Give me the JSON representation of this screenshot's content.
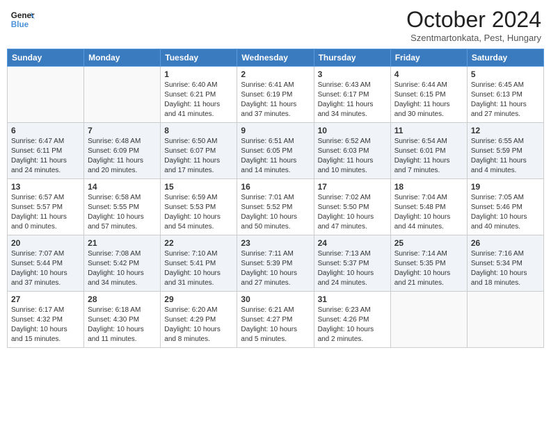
{
  "header": {
    "logo_line1": "General",
    "logo_line2": "Blue",
    "month_title": "October 2024",
    "location": "Szentmartonkata, Pest, Hungary"
  },
  "weekdays": [
    "Sunday",
    "Monday",
    "Tuesday",
    "Wednesday",
    "Thursday",
    "Friday",
    "Saturday"
  ],
  "weeks": [
    [
      {
        "day": "",
        "content": ""
      },
      {
        "day": "",
        "content": ""
      },
      {
        "day": "1",
        "content": "Sunrise: 6:40 AM\nSunset: 6:21 PM\nDaylight: 11 hours and 41 minutes."
      },
      {
        "day": "2",
        "content": "Sunrise: 6:41 AM\nSunset: 6:19 PM\nDaylight: 11 hours and 37 minutes."
      },
      {
        "day": "3",
        "content": "Sunrise: 6:43 AM\nSunset: 6:17 PM\nDaylight: 11 hours and 34 minutes."
      },
      {
        "day": "4",
        "content": "Sunrise: 6:44 AM\nSunset: 6:15 PM\nDaylight: 11 hours and 30 minutes."
      },
      {
        "day": "5",
        "content": "Sunrise: 6:45 AM\nSunset: 6:13 PM\nDaylight: 11 hours and 27 minutes."
      }
    ],
    [
      {
        "day": "6",
        "content": "Sunrise: 6:47 AM\nSunset: 6:11 PM\nDaylight: 11 hours and 24 minutes."
      },
      {
        "day": "7",
        "content": "Sunrise: 6:48 AM\nSunset: 6:09 PM\nDaylight: 11 hours and 20 minutes."
      },
      {
        "day": "8",
        "content": "Sunrise: 6:50 AM\nSunset: 6:07 PM\nDaylight: 11 hours and 17 minutes."
      },
      {
        "day": "9",
        "content": "Sunrise: 6:51 AM\nSunset: 6:05 PM\nDaylight: 11 hours and 14 minutes."
      },
      {
        "day": "10",
        "content": "Sunrise: 6:52 AM\nSunset: 6:03 PM\nDaylight: 11 hours and 10 minutes."
      },
      {
        "day": "11",
        "content": "Sunrise: 6:54 AM\nSunset: 6:01 PM\nDaylight: 11 hours and 7 minutes."
      },
      {
        "day": "12",
        "content": "Sunrise: 6:55 AM\nSunset: 5:59 PM\nDaylight: 11 hours and 4 minutes."
      }
    ],
    [
      {
        "day": "13",
        "content": "Sunrise: 6:57 AM\nSunset: 5:57 PM\nDaylight: 11 hours and 0 minutes."
      },
      {
        "day": "14",
        "content": "Sunrise: 6:58 AM\nSunset: 5:55 PM\nDaylight: 10 hours and 57 minutes."
      },
      {
        "day": "15",
        "content": "Sunrise: 6:59 AM\nSunset: 5:53 PM\nDaylight: 10 hours and 54 minutes."
      },
      {
        "day": "16",
        "content": "Sunrise: 7:01 AM\nSunset: 5:52 PM\nDaylight: 10 hours and 50 minutes."
      },
      {
        "day": "17",
        "content": "Sunrise: 7:02 AM\nSunset: 5:50 PM\nDaylight: 10 hours and 47 minutes."
      },
      {
        "day": "18",
        "content": "Sunrise: 7:04 AM\nSunset: 5:48 PM\nDaylight: 10 hours and 44 minutes."
      },
      {
        "day": "19",
        "content": "Sunrise: 7:05 AM\nSunset: 5:46 PM\nDaylight: 10 hours and 40 minutes."
      }
    ],
    [
      {
        "day": "20",
        "content": "Sunrise: 7:07 AM\nSunset: 5:44 PM\nDaylight: 10 hours and 37 minutes."
      },
      {
        "day": "21",
        "content": "Sunrise: 7:08 AM\nSunset: 5:42 PM\nDaylight: 10 hours and 34 minutes."
      },
      {
        "day": "22",
        "content": "Sunrise: 7:10 AM\nSunset: 5:41 PM\nDaylight: 10 hours and 31 minutes."
      },
      {
        "day": "23",
        "content": "Sunrise: 7:11 AM\nSunset: 5:39 PM\nDaylight: 10 hours and 27 minutes."
      },
      {
        "day": "24",
        "content": "Sunrise: 7:13 AM\nSunset: 5:37 PM\nDaylight: 10 hours and 24 minutes."
      },
      {
        "day": "25",
        "content": "Sunrise: 7:14 AM\nSunset: 5:35 PM\nDaylight: 10 hours and 21 minutes."
      },
      {
        "day": "26",
        "content": "Sunrise: 7:16 AM\nSunset: 5:34 PM\nDaylight: 10 hours and 18 minutes."
      }
    ],
    [
      {
        "day": "27",
        "content": "Sunrise: 6:17 AM\nSunset: 4:32 PM\nDaylight: 10 hours and 15 minutes."
      },
      {
        "day": "28",
        "content": "Sunrise: 6:18 AM\nSunset: 4:30 PM\nDaylight: 10 hours and 11 minutes."
      },
      {
        "day": "29",
        "content": "Sunrise: 6:20 AM\nSunset: 4:29 PM\nDaylight: 10 hours and 8 minutes."
      },
      {
        "day": "30",
        "content": "Sunrise: 6:21 AM\nSunset: 4:27 PM\nDaylight: 10 hours and 5 minutes."
      },
      {
        "day": "31",
        "content": "Sunrise: 6:23 AM\nSunset: 4:26 PM\nDaylight: 10 hours and 2 minutes."
      },
      {
        "day": "",
        "content": ""
      },
      {
        "day": "",
        "content": ""
      }
    ]
  ]
}
